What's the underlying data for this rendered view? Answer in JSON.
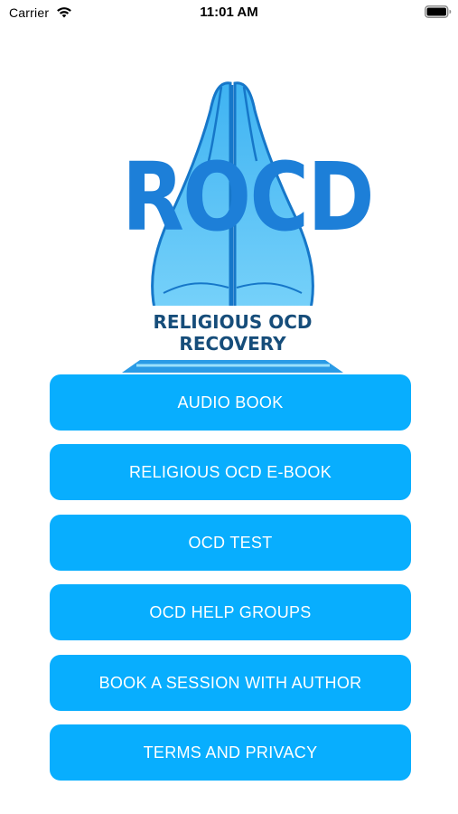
{
  "status_bar": {
    "carrier": "Carrier",
    "time": "11:01 AM",
    "wifi_icon": "wifi-icon",
    "battery_icon": "battery-icon"
  },
  "logo": {
    "word": "ROCD",
    "subtitle_line1": "RELIGIOUS OCD",
    "subtitle_line2": "RECOVERY",
    "icon": "praying-hands-icon"
  },
  "menu": {
    "items": [
      {
        "label": "AUDIO BOOK"
      },
      {
        "label": "RELIGIOUS OCD E-BOOK"
      },
      {
        "label": "OCD TEST"
      },
      {
        "label": "OCD HELP GROUPS"
      },
      {
        "label": "BOOK A SESSION WITH AUTHOR"
      },
      {
        "label": "TERMS AND PRIVACY"
      }
    ]
  },
  "colors": {
    "button": "#08aefe",
    "logo_word": "#1d7fd8",
    "logo_subtitle": "#164d7a",
    "hands_light": "#5ec8f8",
    "hands_dark": "#1677c9"
  }
}
